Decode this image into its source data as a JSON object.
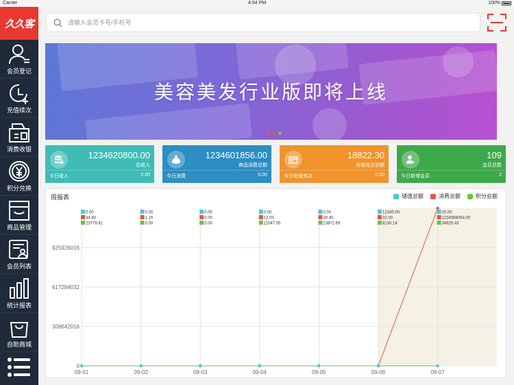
{
  "status_bar": {
    "carrier": "Carrier",
    "time": "4:04 PM",
    "battery": "100%"
  },
  "logo": {
    "text": "久久客"
  },
  "sidebar": {
    "items": [
      {
        "label": "会员登记",
        "icon": "user-register-icon"
      },
      {
        "label": "充值续次",
        "icon": "clock-plus-icon"
      },
      {
        "label": "消费收银",
        "icon": "cash-register-icon"
      },
      {
        "label": "积分兑换",
        "icon": "yen-coin-icon"
      },
      {
        "label": "商品管理",
        "icon": "shopping-basket-icon"
      },
      {
        "label": "会员列表",
        "icon": "member-list-icon"
      },
      {
        "label": "统计报表",
        "icon": "bar-chart-icon"
      },
      {
        "label": "自助商城",
        "icon": "shopping-bag-icon"
      }
    ],
    "menu_icon": "menu-list-icon"
  },
  "search": {
    "placeholder": "请输入会员卡号/手机号"
  },
  "banner": {
    "text": "美容美发行业版即将上线"
  },
  "stats": [
    {
      "value": "1234620800.00",
      "label": "总收入",
      "bottom_label": "今日收入",
      "bottom_value": "0.00",
      "color": "#3fbcb6"
    },
    {
      "value": "1234601856.00",
      "label": "商品消费总额",
      "bottom_label": "今日消费",
      "bottom_value": "0.00",
      "color": "#2c8ec2"
    },
    {
      "value": "18822.30",
      "label": "充值充次总额",
      "bottom_label": "今日充值充次",
      "bottom_value": "0.00",
      "color": "#f0932b"
    },
    {
      "value": "109",
      "label": "会员总数",
      "bottom_label": "今日新增会员",
      "bottom_value": "2",
      "color": "#3da94a"
    }
  ],
  "chart": {
    "title": "周报表",
    "legend": [
      {
        "name": "储值总额",
        "color": "#4fc8d6"
      },
      {
        "name": "消费总额",
        "color": "#e2574c"
      },
      {
        "name": "积分总额",
        "color": "#6cc24a"
      }
    ]
  },
  "chart_data": {
    "type": "line",
    "title": "周报表",
    "categories": [
      "09-01",
      "09-02",
      "09-03",
      "09-04",
      "09-05",
      "09-06",
      "09-07"
    ],
    "y_ticks": [
      "0",
      "308642016",
      "617284032",
      "925926016"
    ],
    "ylim": [
      0,
      1234568064
    ],
    "series": [
      {
        "name": "储值总额",
        "color": "#4fc8d6",
        "labels": [
          "0.00",
          "0.00",
          "0.00",
          "0.00",
          "0.00",
          "12345.00",
          "20.00"
        ],
        "values": [
          0,
          0,
          0,
          0,
          0,
          12345,
          20
        ]
      },
      {
        "name": "消费总额",
        "color": "#e2574c",
        "labels": [
          "34.80",
          "1.20",
          "0.00",
          "12.00",
          "30.40",
          "32.00",
          "1234568064.00"
        ],
        "values": [
          34.8,
          1.2,
          0,
          12,
          30.4,
          32,
          1234568064
        ]
      },
      {
        "name": "积分总额",
        "color": "#6cc24a",
        "labels": [
          "23779.81",
          "0.00",
          "0.00",
          "11047.05",
          "23872.69",
          "8130.14",
          "34920.43"
        ],
        "values": [
          23779.81,
          0,
          0,
          11047.05,
          23872.69,
          8130.14,
          34920.43
        ]
      }
    ]
  }
}
